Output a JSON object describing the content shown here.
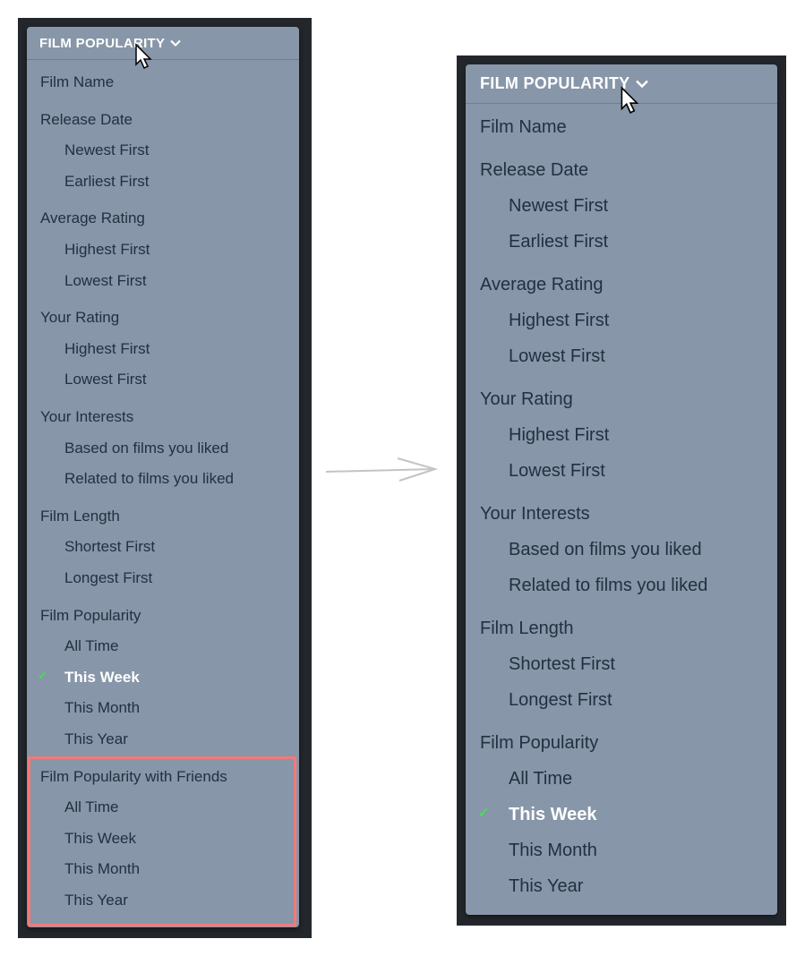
{
  "colors": {
    "menu_bg": "#8796a8",
    "text": "#223140",
    "selected_text": "#ffffff",
    "check": "#43e053",
    "highlight": "#f27a79"
  },
  "left_menu": {
    "header": "FILM POPULARITY",
    "header_icon": "chevron-down-icon",
    "items": [
      {
        "label": "Film Name",
        "level": 0
      },
      {
        "label": "Release Date",
        "level": 0
      },
      {
        "label": "Newest First",
        "level": 1
      },
      {
        "label": "Earliest First",
        "level": 1
      },
      {
        "label": "Average Rating",
        "level": 0
      },
      {
        "label": "Highest First",
        "level": 1
      },
      {
        "label": "Lowest First",
        "level": 1
      },
      {
        "label": "Your Rating",
        "level": 0
      },
      {
        "label": "Highest First",
        "level": 1
      },
      {
        "label": "Lowest First",
        "level": 1
      },
      {
        "label": "Your Interests",
        "level": 0
      },
      {
        "label": "Based on films you liked",
        "level": 1
      },
      {
        "label": "Related to films you liked",
        "level": 1
      },
      {
        "label": "Film Length",
        "level": 0
      },
      {
        "label": "Shortest First",
        "level": 1
      },
      {
        "label": "Longest First",
        "level": 1
      },
      {
        "label": "Film Popularity",
        "level": 0
      },
      {
        "label": "All Time",
        "level": 1
      },
      {
        "label": "This Week",
        "level": 1,
        "selected": true
      },
      {
        "label": "This Month",
        "level": 1
      },
      {
        "label": "This Year",
        "level": 1
      },
      {
        "label": "Film Popularity with Friends",
        "level": 0
      },
      {
        "label": "All Time",
        "level": 1
      },
      {
        "label": "This Week",
        "level": 1
      },
      {
        "label": "This Month",
        "level": 1
      },
      {
        "label": "This Year",
        "level": 1
      }
    ]
  },
  "right_menu": {
    "header": "FILM POPULARITY",
    "header_icon": "chevron-down-icon",
    "items": [
      {
        "label": "Film Name",
        "level": 0
      },
      {
        "label": "Release Date",
        "level": 0
      },
      {
        "label": "Newest First",
        "level": 1
      },
      {
        "label": "Earliest First",
        "level": 1
      },
      {
        "label": "Average Rating",
        "level": 0
      },
      {
        "label": "Highest First",
        "level": 1
      },
      {
        "label": "Lowest First",
        "level": 1
      },
      {
        "label": "Your Rating",
        "level": 0
      },
      {
        "label": "Highest First",
        "level": 1
      },
      {
        "label": "Lowest First",
        "level": 1
      },
      {
        "label": "Your Interests",
        "level": 0
      },
      {
        "label": "Based on films you liked",
        "level": 1
      },
      {
        "label": "Related to films you liked",
        "level": 1
      },
      {
        "label": "Film Length",
        "level": 0
      },
      {
        "label": "Shortest First",
        "level": 1
      },
      {
        "label": "Longest First",
        "level": 1
      },
      {
        "label": "Film Popularity",
        "level": 0
      },
      {
        "label": "All Time",
        "level": 1
      },
      {
        "label": "This Week",
        "level": 1,
        "selected": true
      },
      {
        "label": "This Month",
        "level": 1
      },
      {
        "label": "This Year",
        "level": 1
      }
    ]
  },
  "annotations": {
    "arrow_icon": "arrow-right-icon",
    "cursor_icon": "mouse-pointer-icon"
  }
}
